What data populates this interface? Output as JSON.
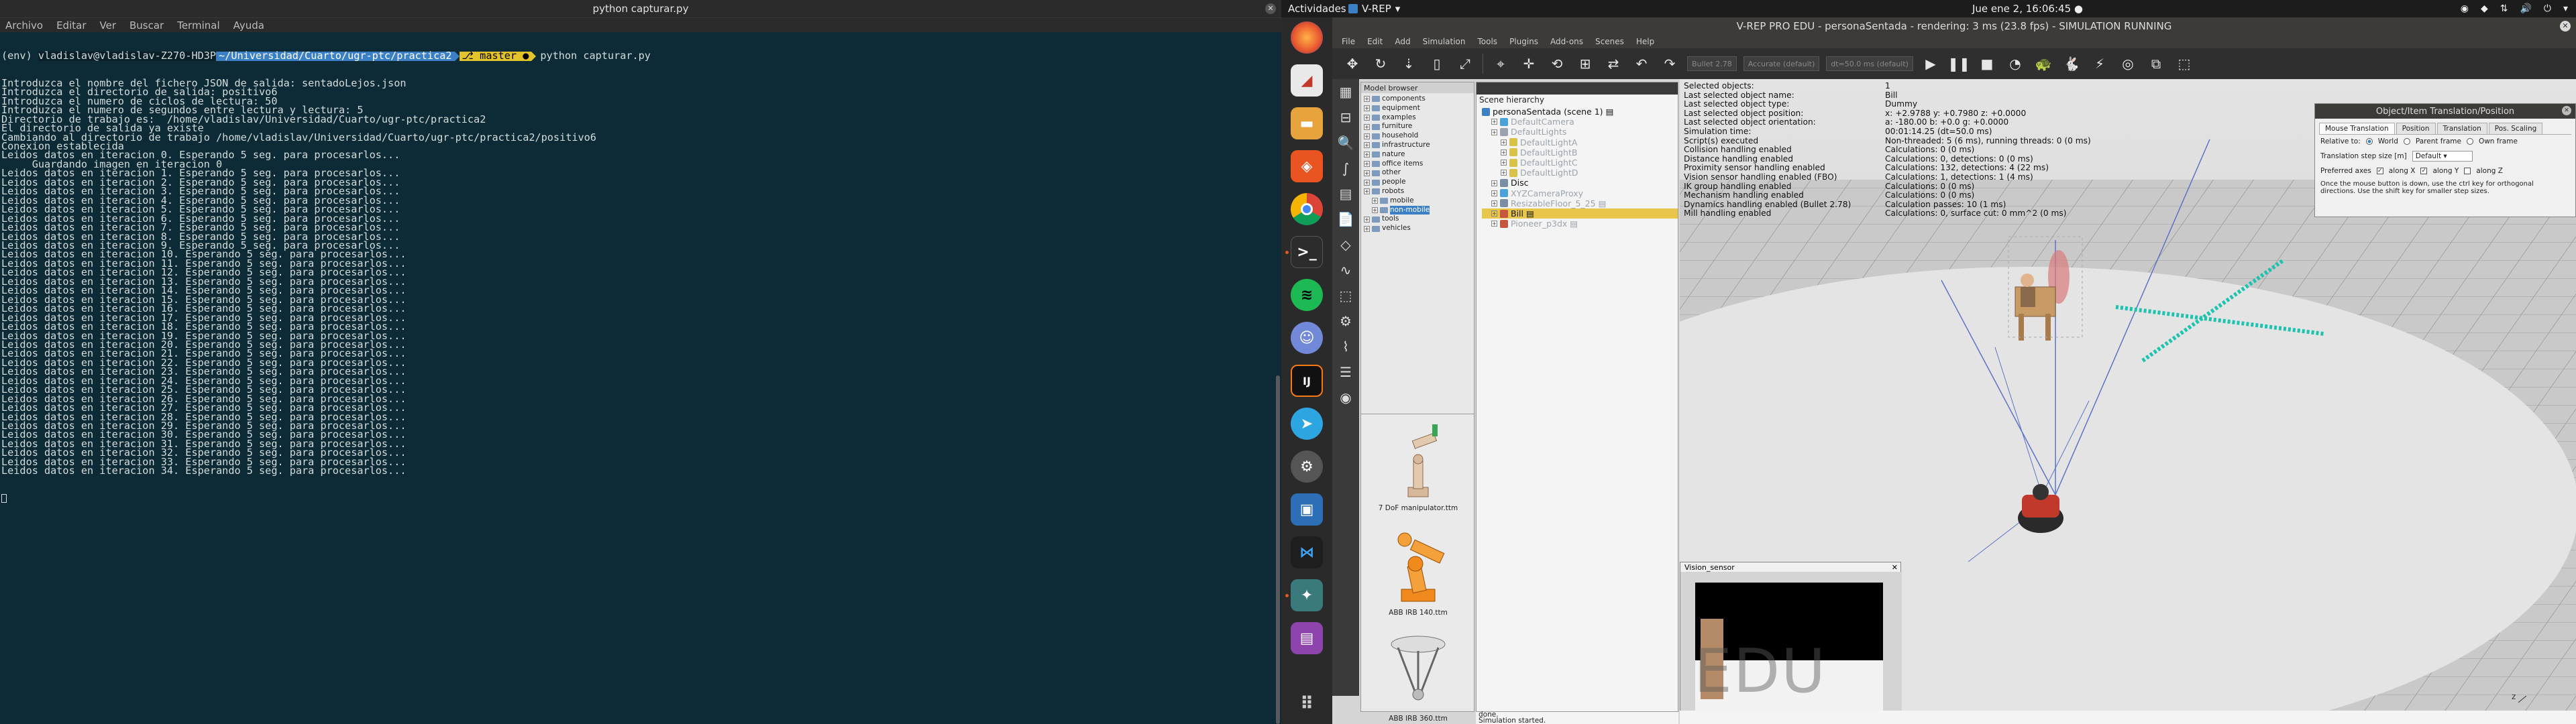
{
  "terminal": {
    "title": "python capturar.py",
    "menu": [
      "Archivo",
      "Editar",
      "Ver",
      "Buscar",
      "Terminal",
      "Ayuda"
    ],
    "prompt": {
      "env": "(env) ",
      "user": "vladislav@vladislav-Z270-HD3P",
      "path": "~/Universidad/Cuarto/ugr-ptc/practica2",
      "git": "master",
      "command": "python capturar.py"
    },
    "lines": [
      "Introduzca el nombre del fichero JSON de salida: sentadoLejos.json",
      "Introduzca el directorio de salida: positivo6",
      "Introduzca el numero de ciclos de lectura: 50",
      "Introduzca el numero de segundos entre lectura y lectura: 5",
      "Directorio de trabajo es:  /home/vladislav/Universidad/Cuarto/ugr-ptc/practica2",
      "El directorio de salida ya existe",
      "Cambiando al directorio de trabajo /home/vladislav/Universidad/Cuarto/ugr-ptc/practica2/positivo6",
      "Conexion establecida",
      "Leidos datos en iteracion 0. Esperando 5 seg. para procesarlos...",
      "     Guardando imagen en iteracion 0",
      "Leidos datos en iteracion 1. Esperando 5 seg. para procesarlos...",
      "Leidos datos en iteracion 2. Esperando 5 seg. para procesarlos...",
      "Leidos datos en iteracion 3. Esperando 5 seg. para procesarlos...",
      "Leidos datos en iteracion 4. Esperando 5 seg. para procesarlos...",
      "Leidos datos en iteracion 5. Esperando 5 seg. para procesarlos...",
      "Leidos datos en iteracion 6. Esperando 5 seg. para procesarlos...",
      "Leidos datos en iteracion 7. Esperando 5 seg. para procesarlos...",
      "Leidos datos en iteracion 8. Esperando 5 seg. para procesarlos...",
      "Leidos datos en iteracion 9. Esperando 5 seg. para procesarlos...",
      "Leidos datos en iteracion 10. Esperando 5 seg. para procesarlos...",
      "Leidos datos en iteracion 11. Esperando 5 seg. para procesarlos...",
      "Leidos datos en iteracion 12. Esperando 5 seg. para procesarlos...",
      "Leidos datos en iteracion 13. Esperando 5 seg. para procesarlos...",
      "Leidos datos en iteracion 14. Esperando 5 seg. para procesarlos...",
      "Leidos datos en iteracion 15. Esperando 5 seg. para procesarlos...",
      "Leidos datos en iteracion 16. Esperando 5 seg. para procesarlos...",
      "Leidos datos en iteracion 17. Esperando 5 seg. para procesarlos...",
      "Leidos datos en iteracion 18. Esperando 5 seg. para procesarlos...",
      "Leidos datos en iteracion 19. Esperando 5 seg. para procesarlos...",
      "Leidos datos en iteracion 20. Esperando 5 seg. para procesarlos...",
      "Leidos datos en iteracion 21. Esperando 5 seg. para procesarlos...",
      "Leidos datos en iteracion 22. Esperando 5 seg. para procesarlos...",
      "Leidos datos en iteracion 23. Esperando 5 seg. para procesarlos...",
      "Leidos datos en iteracion 24. Esperando 5 seg. para procesarlos...",
      "Leidos datos en iteracion 25. Esperando 5 seg. para procesarlos...",
      "Leidos datos en iteracion 26. Esperando 5 seg. para procesarlos...",
      "Leidos datos en iteracion 27. Esperando 5 seg. para procesarlos...",
      "Leidos datos en iteracion 28. Esperando 5 seg. para procesarlos...",
      "Leidos datos en iteracion 29. Esperando 5 seg. para procesarlos...",
      "Leidos datos en iteracion 30. Esperando 5 seg. para procesarlos...",
      "Leidos datos en iteracion 31. Esperando 5 seg. para procesarlos...",
      "Leidos datos en iteracion 32. Esperando 5 seg. para procesarlos...",
      "Leidos datos en iteracion 33. Esperando 5 seg. para procesarlos...",
      "Leidos datos en iteracion 34. Esperando 5 seg. para procesarlos..."
    ]
  },
  "topbar": {
    "activities": "Actividades",
    "app_name": "V-REP",
    "clock": "Jue ene  2, 16:06:45 ●"
  },
  "dock": {
    "icons": [
      "firefox-icon",
      "vrep-icon",
      "files-icon",
      "software-icon",
      "chrome-icon",
      "terminal-icon",
      "spotify-icon",
      "discord-icon",
      "intellij-icon",
      "telegram-icon",
      "settings-icon",
      "virtualbox-icon",
      "vscode-icon",
      "vrep-running-icon",
      "document-icon",
      "apps-grid-icon"
    ]
  },
  "vrep": {
    "title": "V-REP PRO EDU - personaSentada - rendering: 3 ms (23.8 fps) - SIMULATION RUNNING",
    "menu": [
      "File",
      "Edit",
      "Add",
      "Simulation",
      "Tools",
      "Plugins",
      "Add-ons",
      "Scenes",
      "Help"
    ],
    "toolbar_fields": [
      "Bullet 2.78",
      "Accurate (default)",
      "dt=50.0 ms (default)"
    ],
    "model_browser": {
      "header": "Model browser",
      "items": [
        {
          "label": "components",
          "indent": 0
        },
        {
          "label": "equipment",
          "indent": 0
        },
        {
          "label": "examples",
          "indent": 0
        },
        {
          "label": "furniture",
          "indent": 0
        },
        {
          "label": "household",
          "indent": 0
        },
        {
          "label": "infrastructure",
          "indent": 0
        },
        {
          "label": "nature",
          "indent": 0
        },
        {
          "label": "office items",
          "indent": 0
        },
        {
          "label": "other",
          "indent": 0
        },
        {
          "label": "people",
          "indent": 0
        },
        {
          "label": "robots",
          "indent": 0
        },
        {
          "label": "mobile",
          "indent": 1
        },
        {
          "label": "non-mobile",
          "indent": 1,
          "selected": true
        },
        {
          "label": "tools",
          "indent": 0
        },
        {
          "label": "vehicles",
          "indent": 0
        }
      ],
      "thumbs": [
        "7 DoF manipulator.ttm",
        "ABB IRB 140.ttm",
        "ABB IRB 360.ttm"
      ]
    },
    "scene_hierarchy": {
      "header": "Scene hierarchy",
      "items": [
        {
          "label": "personaSentada (scene 1)",
          "indent": 0,
          "color": "#3b7fc4"
        },
        {
          "label": "DefaultCamera",
          "indent": 1,
          "dim": true,
          "color": "#4aa3d8"
        },
        {
          "label": "DefaultLights",
          "indent": 1,
          "dim": true,
          "color": "#9aa3ad"
        },
        {
          "label": "DefaultLightA",
          "indent": 2,
          "dim": true,
          "color": "#d8c24a"
        },
        {
          "label": "DefaultLightB",
          "indent": 2,
          "dim": true,
          "color": "#d8c24a"
        },
        {
          "label": "DefaultLightC",
          "indent": 2,
          "dim": true,
          "color": "#d8c24a"
        },
        {
          "label": "DefaultLightD",
          "indent": 2,
          "dim": true,
          "color": "#d8c24a"
        },
        {
          "label": "Disc",
          "indent": 1,
          "color": "#7a8fa6"
        },
        {
          "label": "XYZCameraProxy",
          "indent": 1,
          "dim": true,
          "color": "#4aa3d8"
        },
        {
          "label": "ResizableFloor_5_25",
          "indent": 1,
          "dim": true,
          "color": "#7a8fa6"
        },
        {
          "label": "Bill",
          "indent": 1,
          "selected": true,
          "color": "#c8553d"
        },
        {
          "label": "Pioneer_p3dx",
          "indent": 1,
          "dim": true,
          "color": "#c8553d"
        }
      ]
    },
    "info": [
      [
        "Selected objects:",
        "1"
      ],
      [
        "Last selected object name:",
        "Bill"
      ],
      [
        "Last selected object type:",
        "Dummy"
      ],
      [
        "Last selected object position:",
        "x: +2.9788 y: +0.7980 z: +0.0000"
      ],
      [
        "Last selected object orientation:",
        "a: -180.00  b: +0.0  g: +0.0000"
      ],
      [
        "Simulation time:",
        "00:01:14.25 (dt=50.0 ms)"
      ],
      [
        "Script(s) executed",
        "Non-threaded: 5 (6 ms), running threads: 0 (0 ms)"
      ],
      [
        "Collision handling enabled",
        "Calculations: 0 (0 ms)"
      ],
      [
        "Distance handling enabled",
        "Calculations: 0, detections: 0 (0 ms)"
      ],
      [
        "Proximity sensor handling enabled",
        "Calculations: 132, detections: 4 (22 ms)"
      ],
      [
        "Vision sensor handling enabled (FBO)",
        "Calculations: 1, detections: 1 (4 ms)"
      ],
      [
        "IK group handling enabled",
        "Calculations: 0 (0 ms)"
      ],
      [
        "Mechanism handling enabled",
        "Calculations: 0 (0 ms)"
      ],
      [
        "Dynamics handling enabled (Bullet 2.78)",
        "Calculation passes: 10 (1 ms)"
      ],
      [
        "Mill handling enabled",
        "Calculations: 0, surface cut: 0 mm^2 (0 ms)"
      ]
    ],
    "vision_sensor": {
      "title": "Vision_sensor",
      "watermark": "EDU"
    },
    "translation_dialog": {
      "title": "Object/Item Translation/Position",
      "tabs": [
        "Mouse Translation",
        "Position",
        "Translation",
        "Pos. Scaling"
      ],
      "relative_to_label": "Relative to:",
      "relative_options": [
        "World",
        "Parent frame",
        "Own frame"
      ],
      "step_label": "Translation step size [m]",
      "step_value": "Default",
      "pref_axes_label": "Preferred axes",
      "axes": [
        "along X",
        "along Y",
        "along Z"
      ],
      "hint": "Once the mouse button is down, use the ctrl key for orthogonal directions. Use the shift key for smaller step sizes."
    },
    "status_lines": [
      "done.",
      "Simulation started."
    ]
  }
}
